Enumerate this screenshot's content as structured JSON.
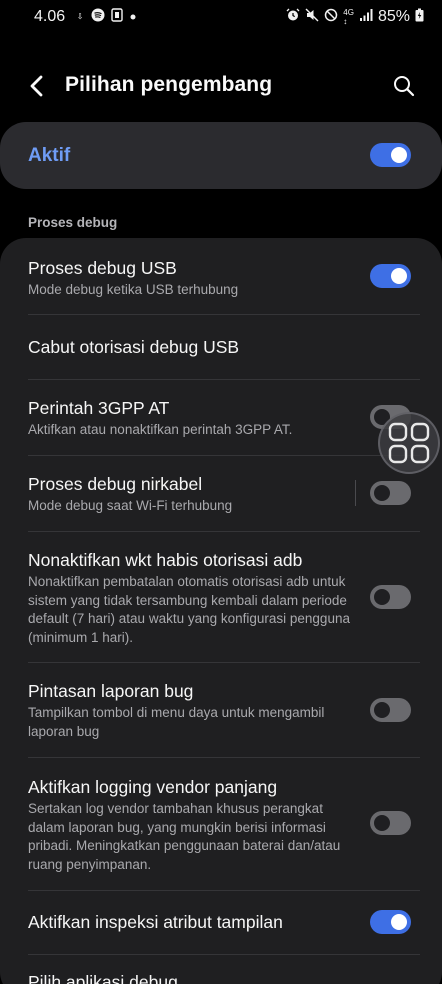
{
  "status_bar": {
    "time": "4.06",
    "left_icons": [
      "usb-storage-icon",
      "spotify-icon",
      "nfc-icon",
      "dot-icon"
    ],
    "right_icons": [
      "alarm-icon",
      "mute-icon",
      "do-not-disturb-icon",
      "lte-icon",
      "signal-icon"
    ],
    "battery": "85%"
  },
  "app_bar": {
    "title": "Pilihan pengembang"
  },
  "master_switch": {
    "label": "Aktif",
    "state": "on",
    "accent": "#6f9cf5"
  },
  "section": {
    "header": "Proses debug"
  },
  "settings": [
    {
      "title": "Proses debug USB",
      "subtitle": "Mode debug ketika USB terhubung",
      "toggle": "on"
    },
    {
      "title": "Cabut otorisasi debug USB",
      "subtitle": null,
      "toggle": null
    },
    {
      "title": "Perintah 3GPP AT",
      "subtitle": "Aktifkan atau nonaktifkan perintah 3GPP AT.",
      "toggle": "off"
    },
    {
      "title": "Proses debug nirkabel",
      "subtitle": "Mode debug saat Wi-Fi terhubung",
      "toggle": "off"
    },
    {
      "title": "Nonaktifkan wkt habis otorisasi adb",
      "subtitle": "Nonaktifkan pembatalan otomatis otorisasi adb untuk sistem yang tidak tersambung kembali dalam periode default (7 hari) atau waktu yang konfigurasi pengguna (minimum 1 hari).",
      "toggle": "off"
    },
    {
      "title": "Pintasan laporan bug",
      "subtitle": "Tampilkan tombol di menu daya untuk mengambil laporan bug",
      "toggle": "off"
    },
    {
      "title": "Aktifkan logging vendor panjang",
      "subtitle": "Sertakan log vendor tambahan khusus perangkat dalam laporan bug, yang mungkin berisi informasi pribadi. Meningkatkan penggunaan baterai dan/atau ruang penyimpanan.",
      "toggle": "off"
    },
    {
      "title": "Aktifkan inspeksi atribut tampilan",
      "subtitle": null,
      "toggle": "on"
    },
    {
      "title": "Pilih aplikasi debug",
      "subtitle": null,
      "toggle": null
    }
  ],
  "colors": {
    "toggle_on": "#3e6fe5",
    "toggle_off": "#6a6a6e",
    "card_bg": "#1f1f21",
    "master_bg": "#2b2b2f"
  }
}
